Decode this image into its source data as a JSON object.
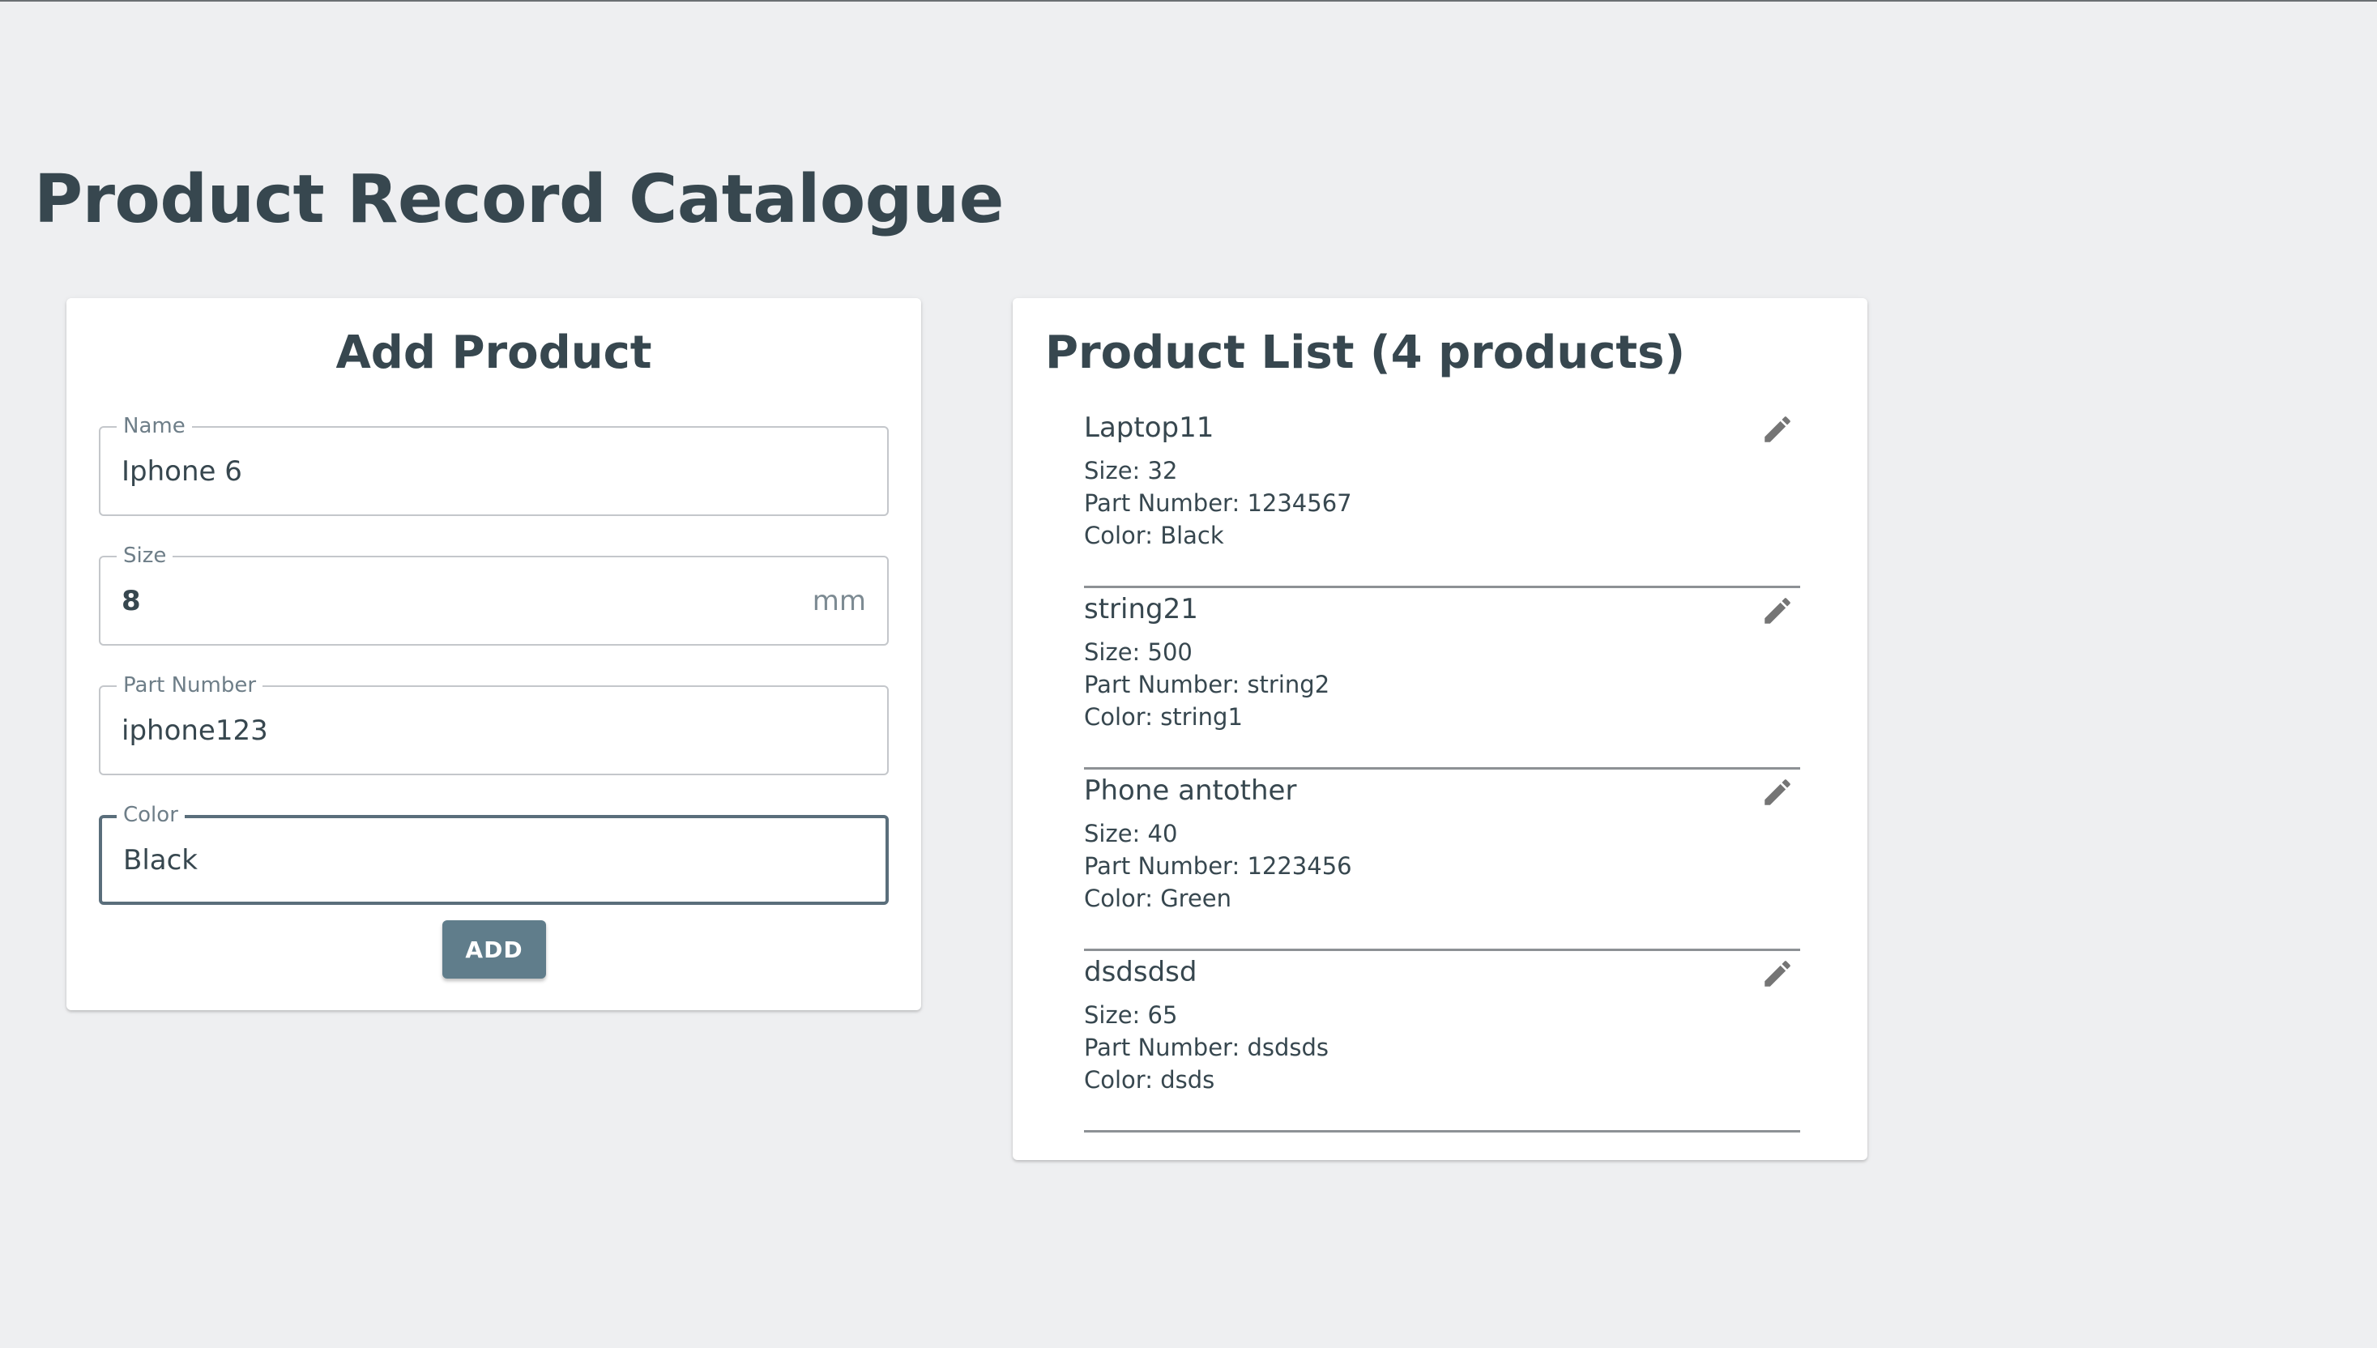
{
  "page": {
    "title": "Product Record Catalogue"
  },
  "add_product": {
    "title": "Add Product",
    "fields": [
      {
        "label": "Name",
        "value": "Iphone 6"
      },
      {
        "label": "Size",
        "value": "8",
        "suffix": "mm"
      },
      {
        "label": "Part Number",
        "value": "iphone123"
      },
      {
        "label": "Color",
        "value": "Black"
      }
    ],
    "add_label": "ADD"
  },
  "product_list": {
    "title": "Product List (4 products)",
    "edit_icon": "pencil-icon",
    "items": [
      {
        "name": "Laptop11",
        "size": "Size: 32",
        "part_number": "Part Number: 1234567",
        "color": "Color: Black"
      },
      {
        "name": "string21",
        "size": "Size: 500",
        "part_number": "Part Number: string2",
        "color": "Color: string1"
      },
      {
        "name": "Phone antother",
        "size": "Size: 40",
        "part_number": "Part Number: 1223456",
        "color": "Color: Green"
      },
      {
        "name": "dsdsdsd",
        "size": "Size: 65",
        "part_number": "Part Number: dsdsds",
        "color": "Color: dsds"
      }
    ]
  },
  "colors": {
    "background": "#eeeff1",
    "text": "#37474f",
    "button": "#607d8b",
    "focused_border": "#5a6e7b",
    "icon": "#757575"
  }
}
